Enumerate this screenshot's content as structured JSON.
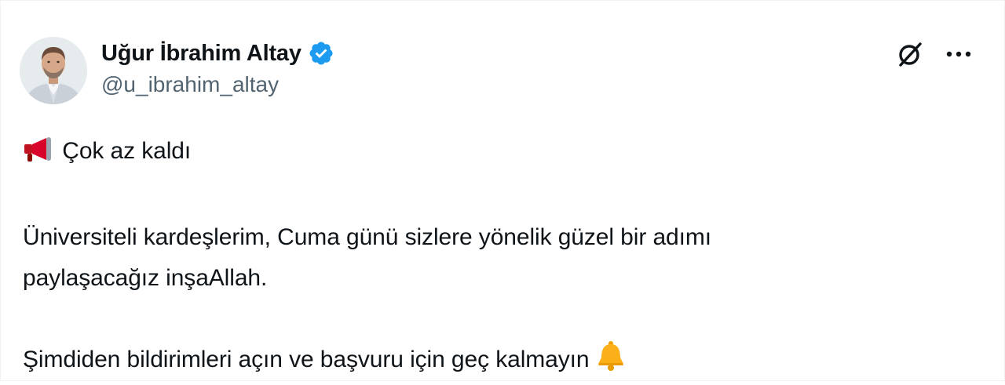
{
  "author": {
    "display_name": "Uğur İbrahim Altay",
    "handle": "@u_ibrahim_altay",
    "verified": true,
    "verified_color": "#1d9bf0"
  },
  "actions": {
    "grok_icon": "grok-icon",
    "more_icon": "more-icon"
  },
  "tweet": {
    "line1_emoji": "megaphone-emoji",
    "line1_text": "Çok az kaldı",
    "para2_line1": "Üniversiteli kardeşlerim, Cuma günü sizlere yönelik güzel bir adımı",
    "para2_line2": "paylaşacağız inşaAllah.",
    "para3_text": "Şimdiden bildirimleri açın ve başvuru için geç kalmayın",
    "para3_emoji": "bell-emoji"
  }
}
